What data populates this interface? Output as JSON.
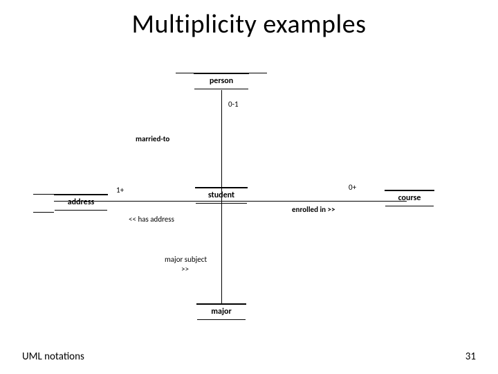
{
  "slide": {
    "title": "Multiplicity examples",
    "footer_left": "UML notations",
    "page_number": "31"
  },
  "boxes": {
    "person": {
      "label": "person"
    },
    "address": {
      "label": "address"
    },
    "student": {
      "label": "student"
    },
    "course": {
      "label": "course"
    },
    "major": {
      "label": "major"
    }
  },
  "labels": {
    "mult_person": "0-1",
    "assoc_married": "married-to",
    "mult_address": "1+",
    "assoc_has_address": "<< has address",
    "mult_course": "0+",
    "assoc_enrolled": "enrolled in >>",
    "assoc_major_l1": "major subject",
    "assoc_major_l2": ">>"
  }
}
